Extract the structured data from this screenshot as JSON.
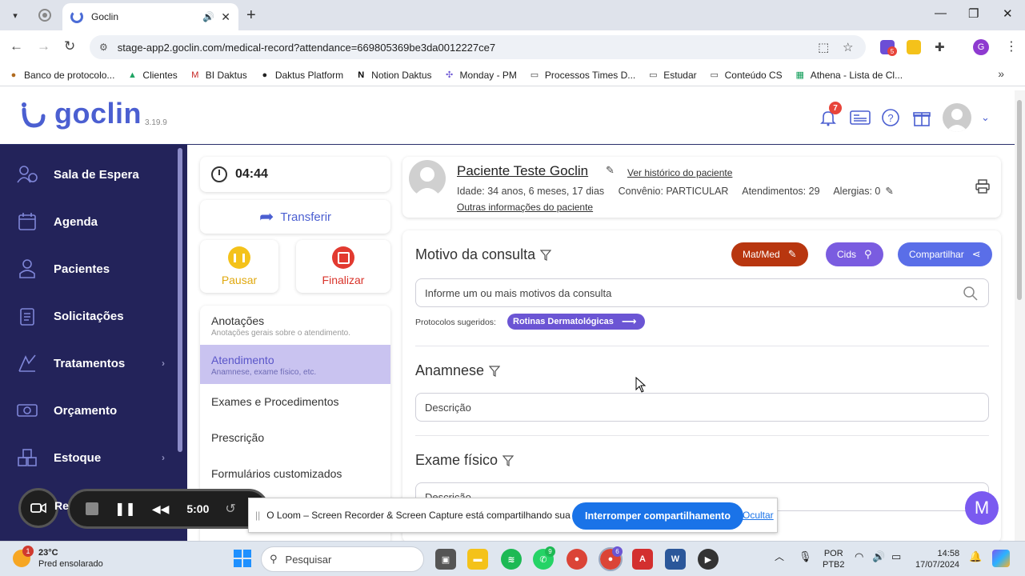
{
  "browser": {
    "tab_title": "Goclin",
    "url": "stage-app2.goclin.com/medical-record?attendance=669805369be3da0012227ce7",
    "bookmarks": [
      {
        "label": "Banco de protocolo...",
        "icon": "cookie-icon"
      },
      {
        "label": "Clientes",
        "icon": "drive-icon"
      },
      {
        "label": "BI Daktus",
        "icon": "gmail-icon"
      },
      {
        "label": "Daktus Platform",
        "icon": "daktus-icon"
      },
      {
        "label": "Notion Daktus",
        "icon": "notion-icon"
      },
      {
        "label": "Monday - PM",
        "icon": "monday-icon"
      },
      {
        "label": "Processos Times D...",
        "icon": "folder-icon"
      },
      {
        "label": "Estudar",
        "icon": "folder-icon"
      },
      {
        "label": "Conteúdo CS",
        "icon": "folder-icon"
      },
      {
        "label": "Athena - Lista de Cl...",
        "icon": "sheets-icon"
      }
    ],
    "ext_badge": "5"
  },
  "header": {
    "logo": "goclin",
    "version": "3.19.9",
    "notifications_count": "7"
  },
  "sidebar": {
    "items": [
      {
        "label": "Sala de Espera",
        "icon": "waiting-room-icon",
        "arrow": ""
      },
      {
        "label": "Agenda",
        "icon": "calendar-icon",
        "arrow": ""
      },
      {
        "label": "Pacientes",
        "icon": "patients-icon",
        "arrow": ""
      },
      {
        "label": "Solicitações",
        "icon": "requests-icon",
        "arrow": ""
      },
      {
        "label": "Tratamentos",
        "icon": "treatments-icon",
        "arrow": "›"
      },
      {
        "label": "Orçamento",
        "icon": "budget-icon",
        "arrow": ""
      },
      {
        "label": "Estoque",
        "icon": "stock-icon",
        "arrow": "›"
      }
    ]
  },
  "attendance": {
    "timer": "04:44",
    "transfer_label": "Transferir",
    "pause_label": "Pausar",
    "finish_label": "Finalizar",
    "menu": [
      {
        "title": "Anotações",
        "subtitle": "Anotações gerais sobre o atendimento."
      },
      {
        "title": "Atendimento",
        "subtitle": "Anamnese, exame físico, etc."
      },
      {
        "title": "Exames e Procedimentos",
        "subtitle": ""
      },
      {
        "title": "Prescrição",
        "subtitle": ""
      },
      {
        "title": "Formulários customizados",
        "subtitle": ""
      }
    ]
  },
  "patient": {
    "name": "Paciente Teste Goclin",
    "history_link": "Ver histórico do paciente",
    "age": "Idade: 34 anos, 6 meses, 17 dias",
    "insurance": "Convênio: PARTICULAR",
    "visits": "Atendimentos: 29",
    "allergies": "Alergias: 0",
    "more_link": "Outras informações do paciente"
  },
  "record": {
    "motivo_title": "Motivo da consulta",
    "matmed_label": "Mat/Med",
    "cids_label": "Cids",
    "share_label": "Compartilhar",
    "motivo_placeholder": "Informe um ou mais motivos da consulta",
    "protocols_label": "Protocolos sugeridos:",
    "protocol_tag": "Rotinas Dermatológicas",
    "anamnese_title": "Anamnese",
    "anamnese_placeholder": "Descrição",
    "exame_title": "Exame físico",
    "exame_placeholder": "Descrição"
  },
  "loom": {
    "timer": "5:00",
    "share_message": "O Loom – Screen Recorder & Screen Capture está compartilhando sua tela.",
    "stop_label": "Interromper compartilhamento",
    "hide_label": "Ocultar",
    "chat_letter": "M",
    "toolbar_label_partial": "Re"
  },
  "taskbar": {
    "temp": "23°C",
    "weather": "Pred ensolarado",
    "weather_badge": "1",
    "search": "Pesquisar",
    "lang": "POR",
    "layout": "PTB2",
    "time": "14:58",
    "date": "17/07/2024",
    "whatsapp_badge": "9",
    "chrome_badge": "6"
  },
  "colors": {
    "sidebar": "#23235a",
    "brand": "#4b5fd1",
    "matmed": "#b8360f",
    "cids": "#7a5ce0",
    "share": "#5a6ee8",
    "active_menu": "#c9c3f0"
  }
}
